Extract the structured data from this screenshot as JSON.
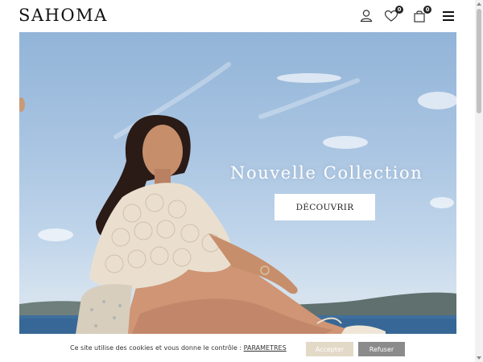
{
  "header": {
    "logo": "SAHOMA",
    "wishlist_count": "0",
    "cart_count": "0",
    "icons": [
      "account-icon",
      "heart-icon",
      "bag-icon",
      "menu-icon"
    ]
  },
  "hero": {
    "title": "Nouvelle Collection",
    "button_label": "DÉCOUVRIR"
  },
  "cookie_banner": {
    "text": "Ce site utilise des cookies et vous donne le contrôle : ",
    "link_label": "PARAMETRES",
    "accept_label": "Accepter",
    "refuse_label": "Refuser"
  },
  "colors": {
    "accept_button": "#e3d9c7",
    "refuse_button": "#8b8b8b",
    "sky": "#a7c3e1",
    "badge": "#222222"
  }
}
